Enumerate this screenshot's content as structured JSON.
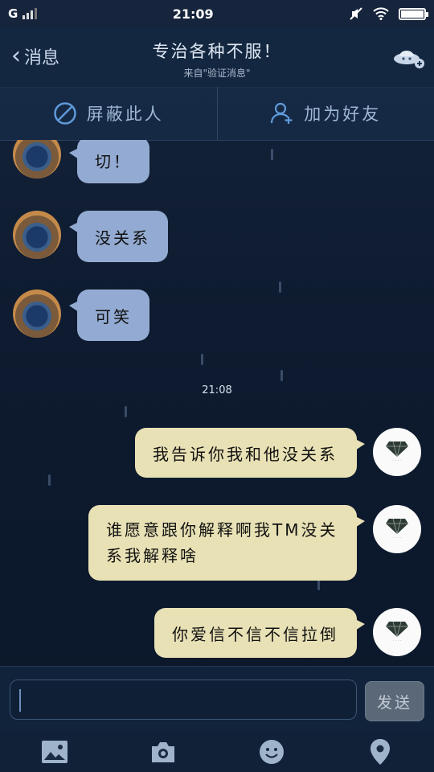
{
  "status_bar": {
    "carrier": "G",
    "time": "21:09",
    "battery_level": 0.95
  },
  "header": {
    "back_label": "消息",
    "title": "专治各种不服！",
    "subtitle": "来自\"验证消息\""
  },
  "actions": {
    "block_label": "屏蔽此人",
    "add_friend_label": "加为好友"
  },
  "messages": {
    "in_1": "切！",
    "in_2": "没关系",
    "in_3": "可笑",
    "timestamp": "21:08",
    "out_1": "我告诉你我和他没关系",
    "out_2": "谁愿意跟你解释啊我TM没关系我解释啥",
    "out_3": "你爱信不信不信拉倒"
  },
  "input": {
    "value": "",
    "send_label": "发送"
  },
  "colors": {
    "incoming_bubble": "#93abd2",
    "outgoing_bubble": "#e8e1b5",
    "action_text": "#9fb8d6"
  },
  "toolbar": {
    "icons": [
      "image-icon",
      "camera-icon",
      "emoji-icon",
      "location-icon"
    ]
  }
}
